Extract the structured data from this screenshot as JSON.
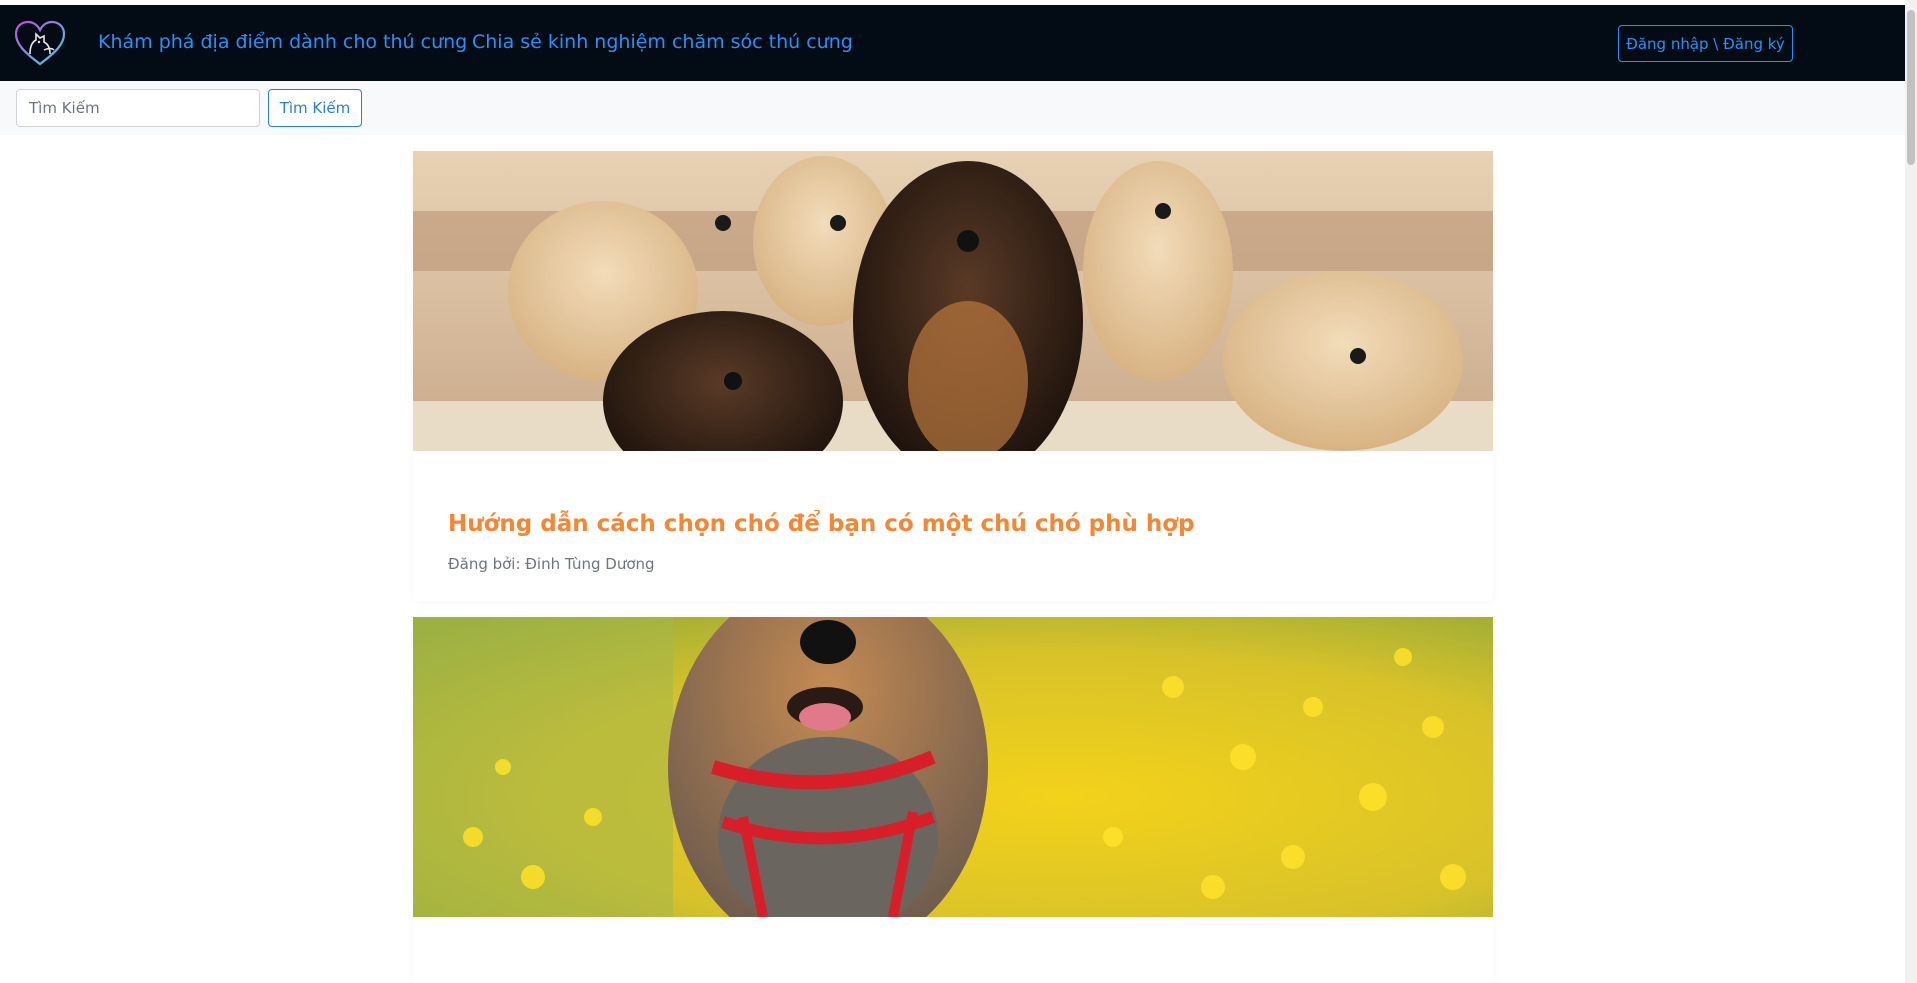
{
  "navbar": {
    "links": [
      {
        "label": "Khám phá địa điểm dành cho thú cưng"
      },
      {
        "label": "Chia sẻ kinh nghiệm chăm sóc thú cưng"
      }
    ],
    "login_label": "Đăng nhập \\ Đăng ký"
  },
  "search": {
    "placeholder": "Tìm Kiếm",
    "value": "",
    "button_label": "Tìm Kiếm"
  },
  "posts": [
    {
      "title": "Hướng dẫn cách chọn chó để bạn có một chú chó phù hợp",
      "author": "Đăng bởi: Đinh Tùng Dương"
    },
    {
      "title": "",
      "author": ""
    }
  ],
  "colors": {
    "navbar_bg": "#030c15",
    "link": "#2a8ff7",
    "title_orange": "#f58634"
  }
}
